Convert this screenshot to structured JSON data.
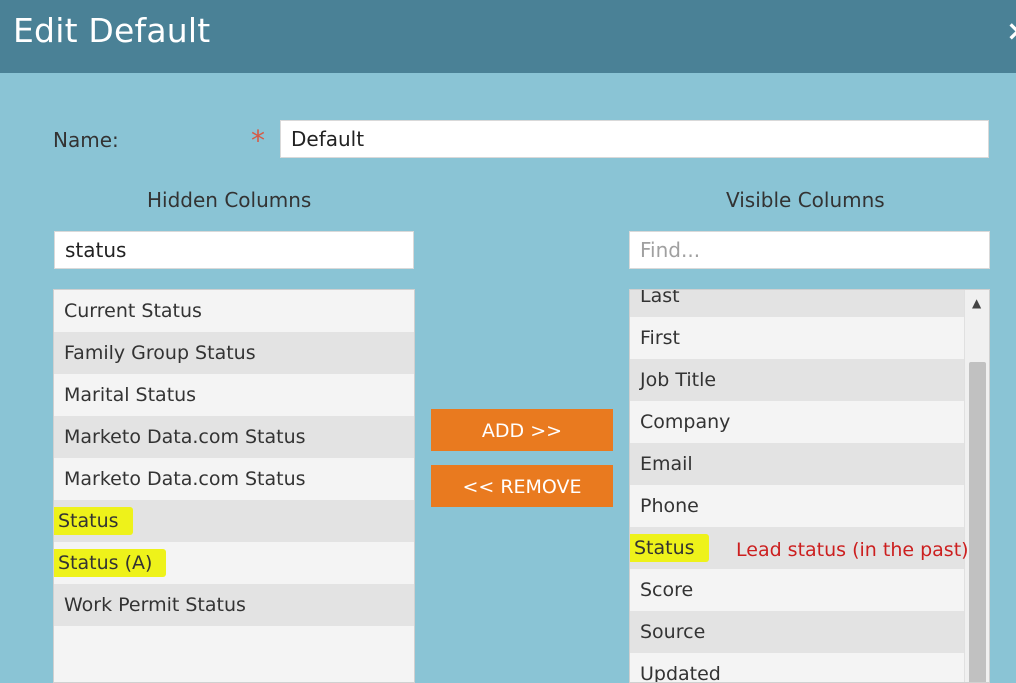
{
  "dialog": {
    "title": "Edit Default",
    "close_icon": "×"
  },
  "name": {
    "label": "Name:",
    "required_marker": "*",
    "value": "Default"
  },
  "hidden_columns": {
    "heading": "Hidden Columns",
    "search_value": "status",
    "items": [
      {
        "label": "Current Status"
      },
      {
        "label": "Family Group Status"
      },
      {
        "label": "Marital Status"
      },
      {
        "label": "Marketo Data.com Status"
      },
      {
        "label": "Marketo Data.com Status"
      },
      {
        "label": "Status",
        "highlighted": true
      },
      {
        "label": "Status (A)",
        "highlighted": true
      },
      {
        "label": "Work Permit Status"
      }
    ]
  },
  "buttons": {
    "add": "ADD >>",
    "remove": "<< REMOVE"
  },
  "visible_columns": {
    "heading": "Visible Columns",
    "search_placeholder": "Find...",
    "items": [
      {
        "label": "Last"
      },
      {
        "label": "First"
      },
      {
        "label": "Job Title"
      },
      {
        "label": "Company"
      },
      {
        "label": "Email"
      },
      {
        "label": "Phone"
      },
      {
        "label": "Status",
        "highlighted": true
      },
      {
        "label": "Score"
      },
      {
        "label": "Source"
      },
      {
        "label": "Updated"
      }
    ],
    "annotation": "Lead status (in the past)"
  },
  "colors": {
    "title_bar": "#4a8196",
    "dialog_bg": "#8ac4d5",
    "button": "#e97a1f",
    "highlight": "#eef21a",
    "annotation": "#cc1f1f",
    "required": "#d65b46"
  }
}
